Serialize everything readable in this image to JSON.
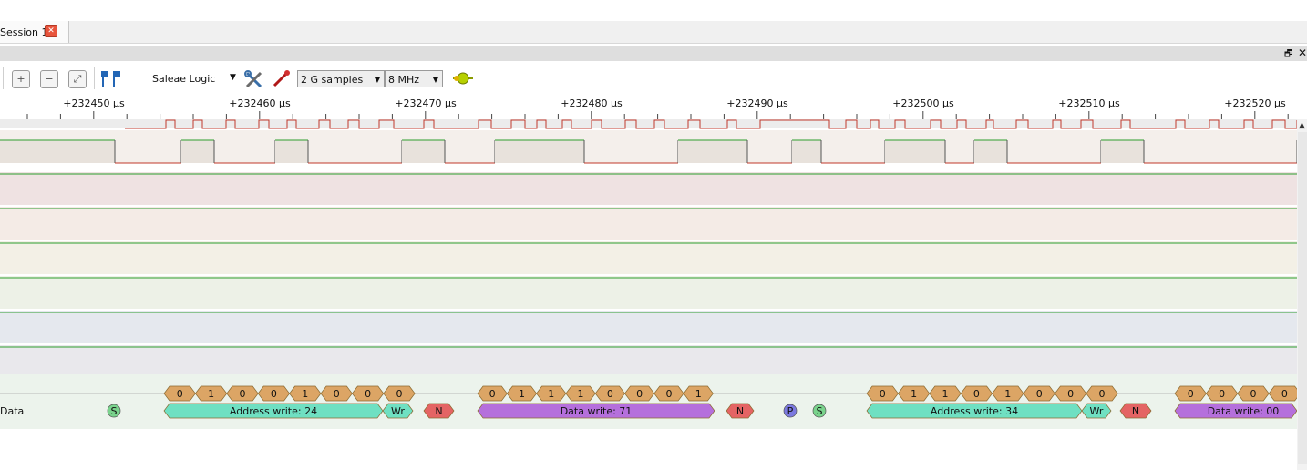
{
  "tab": {
    "label": "Session 1",
    "close_icon": "close-icon"
  },
  "window": {
    "restore_icon": "🗗",
    "close_icon": "✕"
  },
  "toolbar": {
    "device": "Saleae Logic",
    "samples": "2 G samples",
    "rate": "8 MHz",
    "icons": [
      "zoom-in-icon",
      "zoom-out-icon",
      "fit-icon",
      "markers-icon",
      "settings-icon",
      "probe-icon",
      "start-icon"
    ]
  },
  "ruler": {
    "labels": [
      "+232450 μs",
      "+232460 μs",
      "+232470 μs",
      "+232480 μs",
      "+232490 μs",
      "+232500 μs",
      "+232510 μs",
      "+232520 μs"
    ]
  },
  "channels": {
    "colors": [
      "#ececec",
      "#f4efeb",
      "#efe2e2",
      "#f4ebe6",
      "#f3f0e6",
      "#edf1e7",
      "#e5e8ee",
      "#e9e8ec",
      "#ecf3ec"
    ]
  },
  "decoder": {
    "row_label": "Data",
    "bits": [
      [
        "0",
        "1",
        "0",
        "0",
        "1",
        "0",
        "0",
        "0"
      ],
      [
        "0",
        "1",
        "1",
        "1",
        "0",
        "0",
        "0",
        "1"
      ],
      [
        "0",
        "1",
        "1",
        "0",
        "1",
        "0",
        "0",
        "0"
      ],
      [
        "0",
        "0",
        "0",
        "0"
      ]
    ],
    "markers": {
      "start": "S",
      "stop": "P",
      "nack": "N",
      "write": "Wr"
    },
    "frames": [
      "Address write: 24",
      "Data write: 71",
      "Address write: 34",
      "Data write: 00"
    ],
    "colors": {
      "bit": "#dca565",
      "address": "#6fe0c2",
      "data": "#b56fdc",
      "nack": "#e46464",
      "start": "#79d38c",
      "stop": "#7b79e0"
    }
  }
}
